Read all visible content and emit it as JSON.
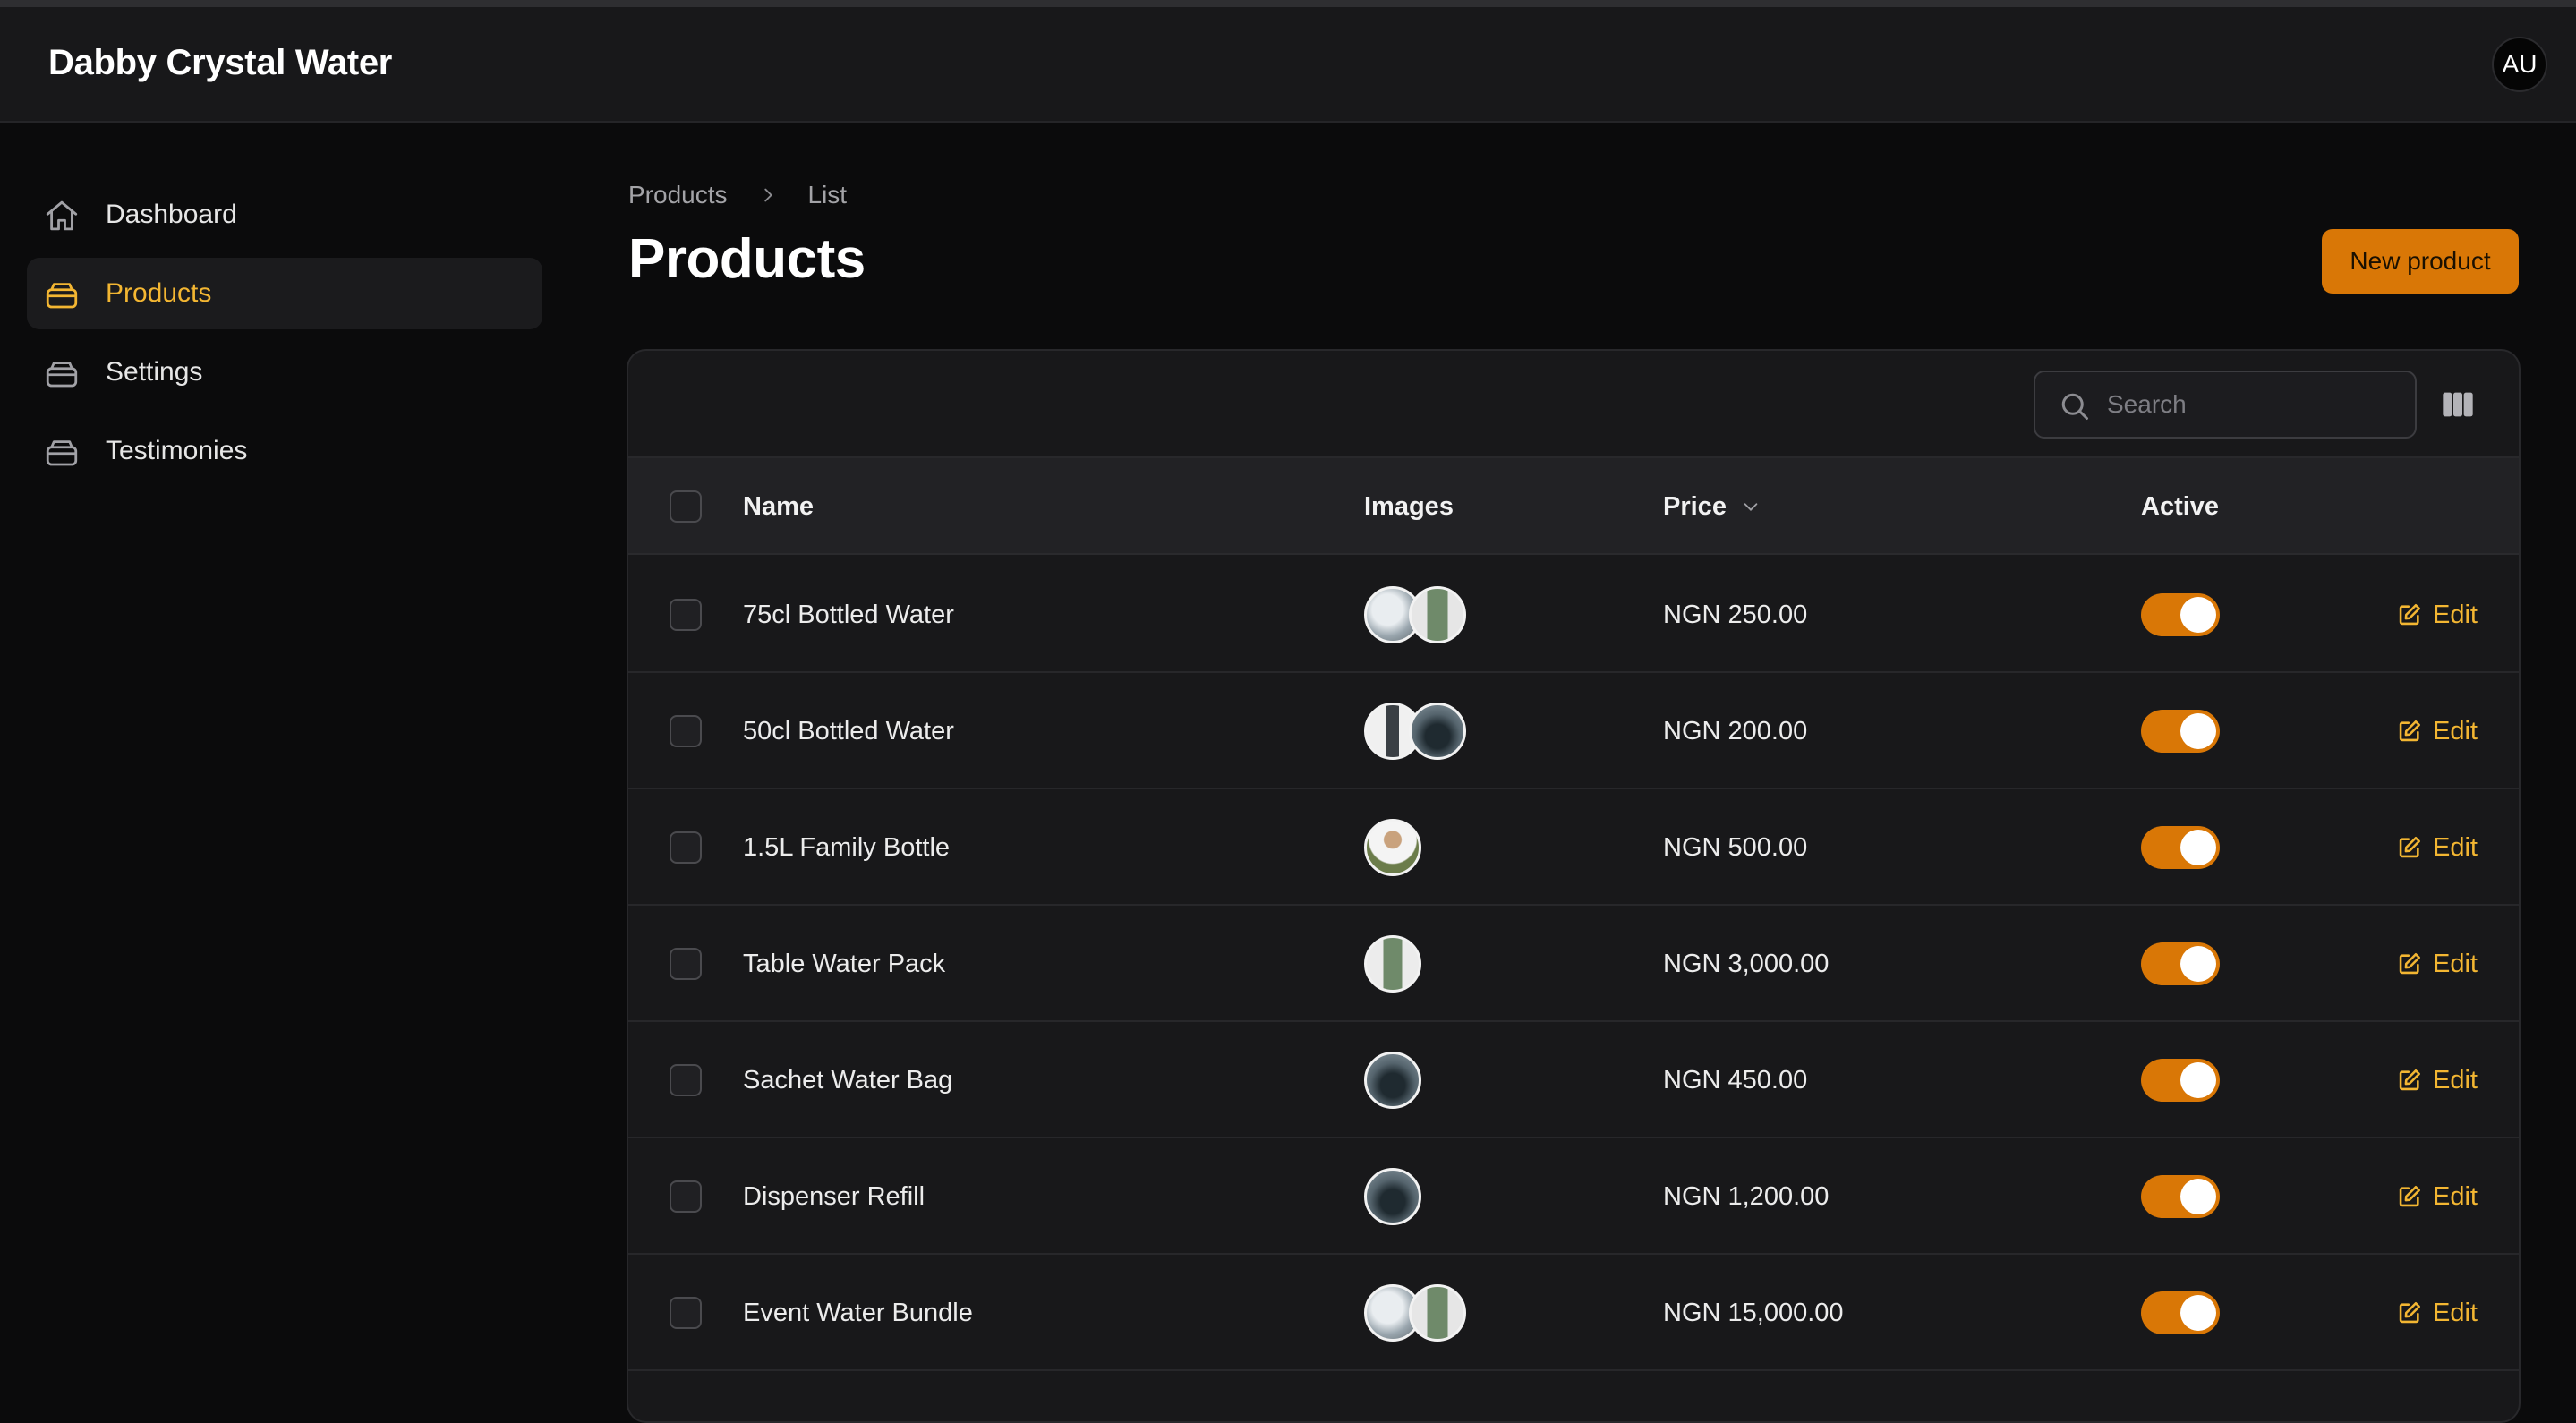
{
  "app": {
    "brand": "Dabby Crystal Water",
    "avatar_initials": "AU"
  },
  "sidebar": {
    "items": [
      {
        "label": "Dashboard",
        "icon": "home-icon",
        "active": false
      },
      {
        "label": "Products",
        "icon": "tray-icon",
        "active": true
      },
      {
        "label": "Settings",
        "icon": "tray-icon",
        "active": false
      },
      {
        "label": "Testimonies",
        "icon": "tray-icon",
        "active": false
      }
    ]
  },
  "breadcrumb": {
    "items": [
      "Products",
      "List"
    ]
  },
  "page": {
    "title": "Products",
    "new_button": "New product"
  },
  "search": {
    "placeholder": "Search"
  },
  "table": {
    "columns": {
      "name": "Name",
      "images": "Images",
      "price": "Price",
      "active": "Active"
    },
    "edit_label": "Edit",
    "rows": [
      {
        "name": "75cl Bottled Water",
        "images": [
          "dispenser-photo",
          "green-bottle-photo"
        ],
        "price": "NGN 250.00",
        "active": true
      },
      {
        "name": "50cl Bottled Water",
        "images": [
          "bottle-pack-photo",
          "dark-bottle-photo"
        ],
        "price": "NGN 200.00",
        "active": true
      },
      {
        "name": "1.5L Family Bottle",
        "images": [
          "person-photo"
        ],
        "price": "NGN 500.00",
        "active": true
      },
      {
        "name": "Table Water Pack",
        "images": [
          "green-bottle-photo"
        ],
        "price": "NGN 3,000.00",
        "active": true
      },
      {
        "name": "Sachet Water Bag",
        "images": [
          "dark-bottle-photo"
        ],
        "price": "NGN 450.00",
        "active": true
      },
      {
        "name": "Dispenser Refill",
        "images": [
          "dark-bottle-photo"
        ],
        "price": "NGN 1,200.00",
        "active": true
      },
      {
        "name": "Event Water Bundle",
        "images": [
          "dispenser-photo",
          "green-bottle-photo"
        ],
        "price": "NGN 15,000.00",
        "active": true
      }
    ]
  },
  "colors": {
    "accent": "#d97706",
    "accent_text": "#f3b632",
    "background": "#0b0b0c",
    "panel": "#18181a"
  }
}
